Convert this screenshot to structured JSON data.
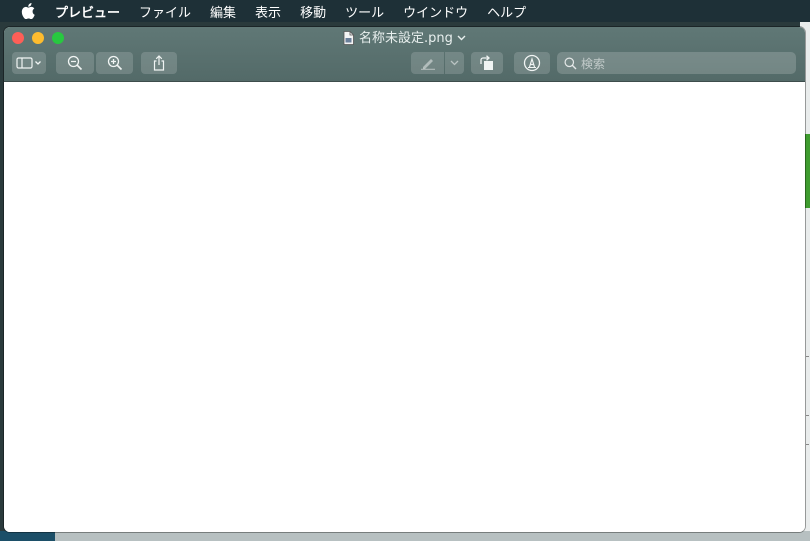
{
  "menubar": {
    "app_name": "プレビュー",
    "items": [
      "ファイル",
      "編集",
      "表示",
      "移動",
      "ツール",
      "ウインドウ",
      "ヘルプ"
    ]
  },
  "window": {
    "title": "名称未設定.png"
  },
  "toolbar": {
    "search_placeholder": "検索"
  },
  "icons": {
    "apple": "apple-logo-icon",
    "sidebar": "sidebar-toggle-icon",
    "zoom_out": "zoom-out-icon",
    "zoom_in": "zoom-in-icon",
    "share": "share-icon",
    "highlight": "highlighter-icon",
    "rotate": "rotate-icon",
    "markup": "markup-icon",
    "search": "search-icon"
  },
  "colors": {
    "titlebar": "#5b7270",
    "close": "#fe5f57",
    "minimize": "#febc2e",
    "maximize": "#28c840"
  }
}
